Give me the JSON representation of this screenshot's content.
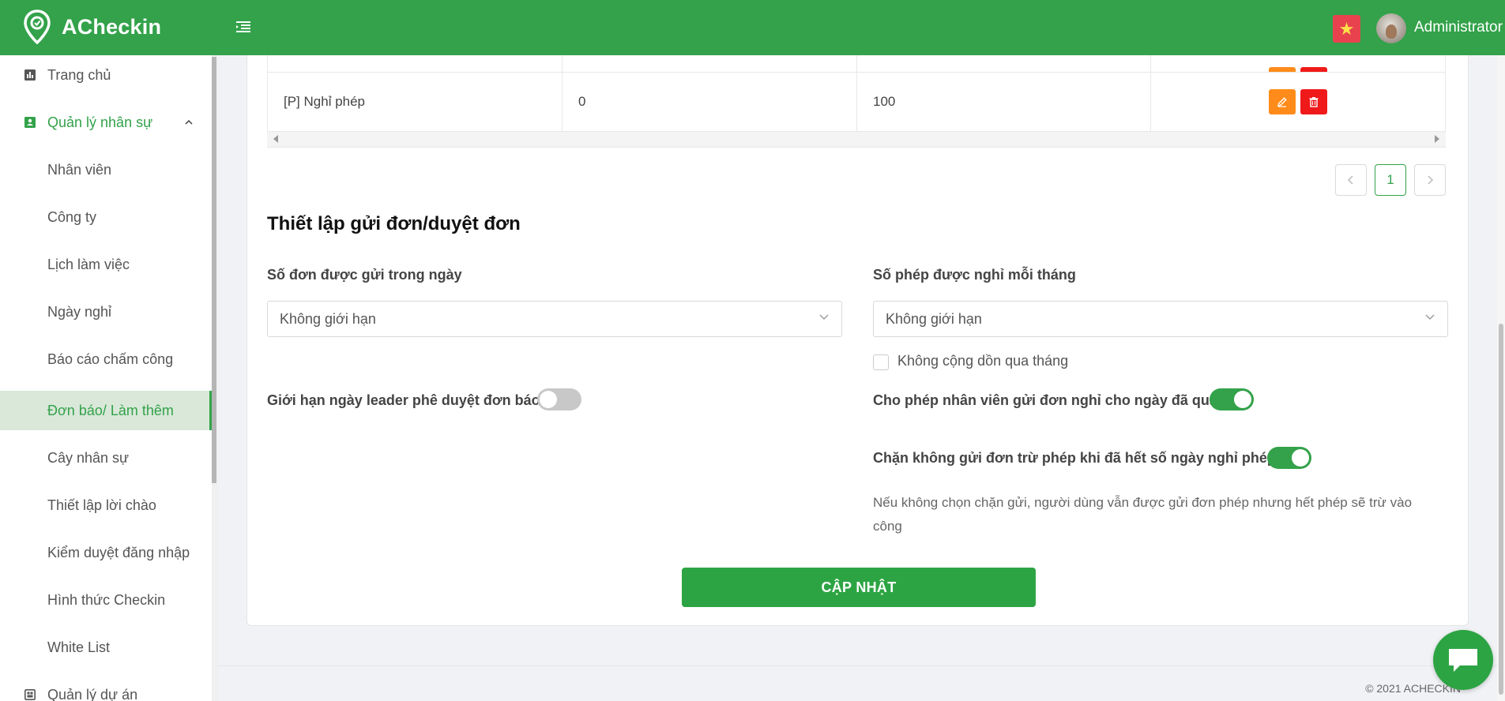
{
  "app": {
    "name": "ACheckin",
    "brand_color": "#33a24a"
  },
  "header": {
    "user_name": "Administrator",
    "language_flag": "vietnam-flag-icon"
  },
  "sidebar": {
    "items": [
      {
        "label": "Trang chủ",
        "icon": "chart-icon"
      },
      {
        "label": "Quản lý nhân sự",
        "icon": "id-card-icon"
      },
      {
        "label": "Nhân viên"
      },
      {
        "label": "Công ty"
      },
      {
        "label": "Lịch làm việc"
      },
      {
        "label": "Ngày nghỉ"
      },
      {
        "label": "Báo cáo chấm công"
      },
      {
        "label": "Đơn báo/ Làm thêm"
      },
      {
        "label": "Cây nhân sự"
      },
      {
        "label": "Thiết lập lời chào"
      },
      {
        "label": "Kiểm duyệt đăng nhập"
      },
      {
        "label": "Hình thức Checkin"
      },
      {
        "label": "White List"
      },
      {
        "label": "Quản lý dự án",
        "icon": "project-icon"
      }
    ]
  },
  "table": {
    "rows": [
      {
        "name": "[P] Nghỉ phép",
        "col2": "0",
        "col3": "100"
      }
    ]
  },
  "pagination": {
    "current_page": "1"
  },
  "settings": {
    "title": "Thiết lập gửi đơn/duyệt đơn",
    "daily_requests_label": "Số đơn được gửi trong ngày",
    "daily_requests_value": "Không giới hạn",
    "monthly_leave_label": "Số phép được nghỉ mỗi tháng",
    "monthly_leave_value": "Không giới hạn",
    "no_carryover_label": "Không cộng dồn qua tháng",
    "leader_limit_label": "Giới hạn ngày leader phê duyệt đơn báo",
    "leader_limit_on": false,
    "allow_past_leave_label": "Cho phép nhân viên gửi đơn nghỉ cho ngày đã qua",
    "allow_past_leave_on": true,
    "block_when_exhausted_label": "Chặn không gửi đơn trừ phép khi đã hết số ngày nghỉ phép",
    "block_when_exhausted_on": true,
    "note": "Nếu không chọn chặn gửi, người dùng vẫn được gửi đơn phép nhưng hết phép sẽ trừ vào công",
    "update_label": "CẬP NHẬT"
  },
  "footer": {
    "copyright": "© 2021 ACHECKIN"
  }
}
